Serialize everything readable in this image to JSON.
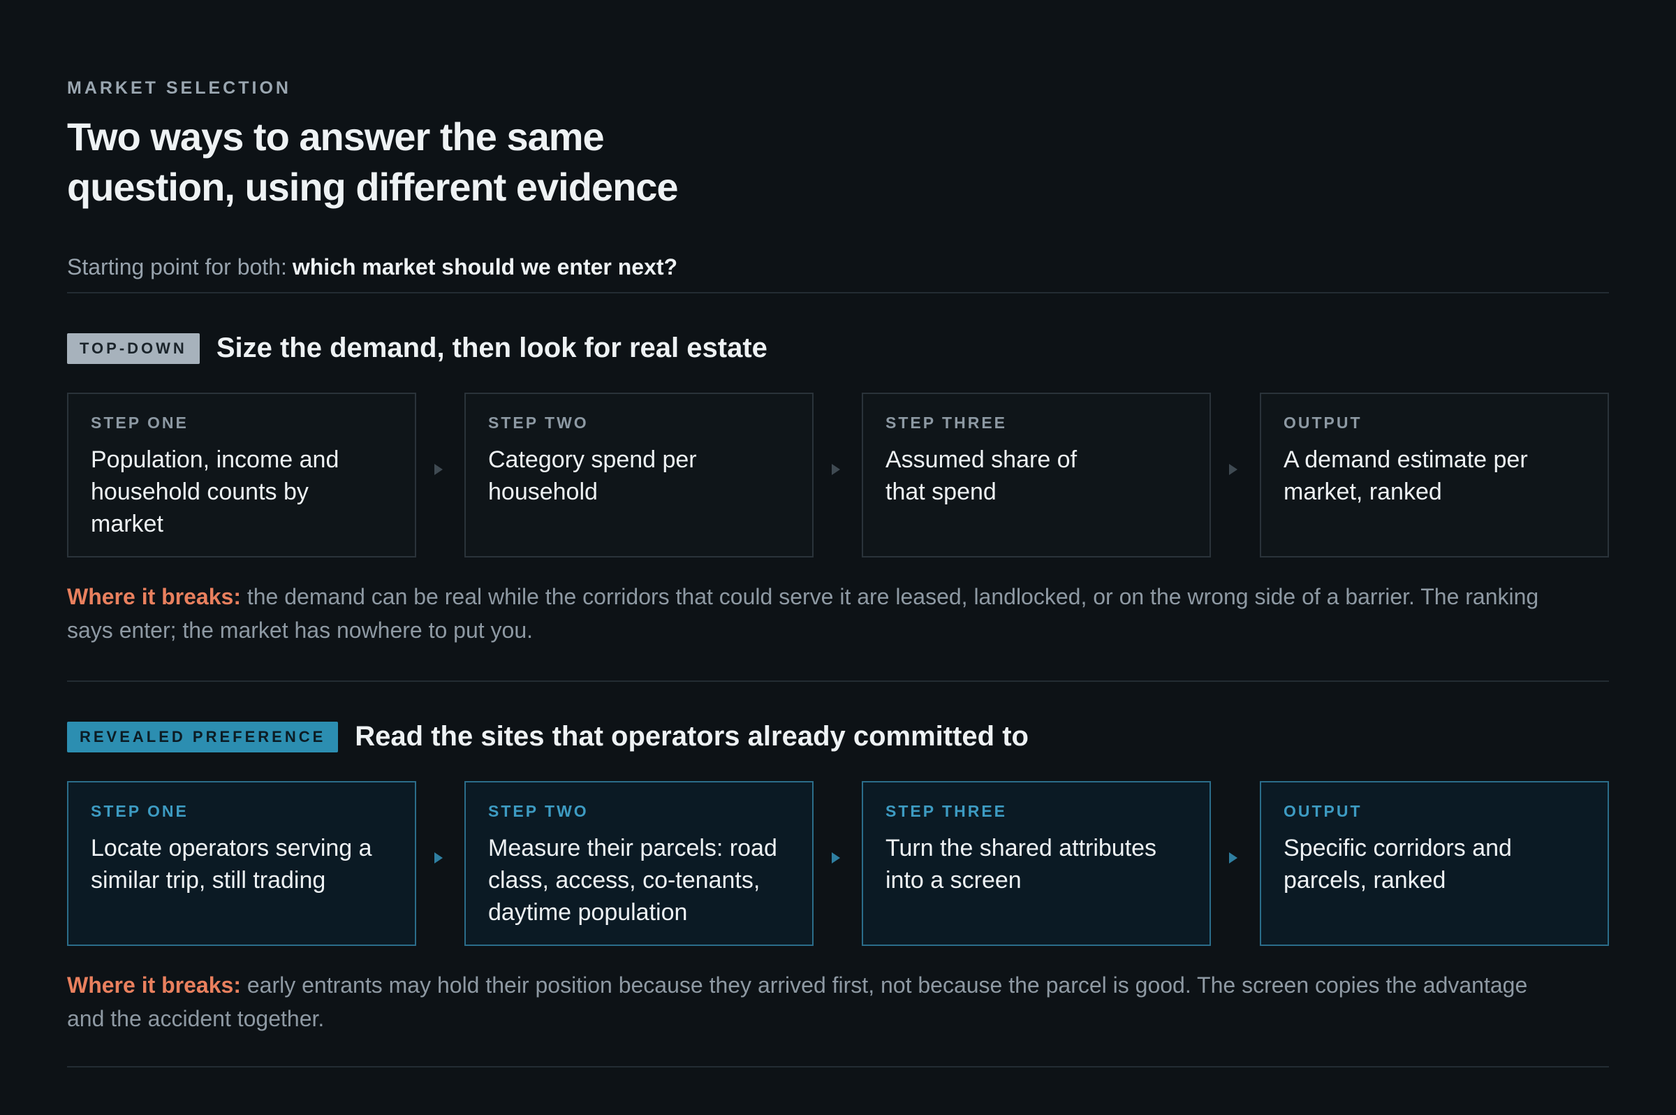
{
  "header": {
    "eyebrow": "MARKET SELECTION",
    "headline_line1": "Two ways to answer the same",
    "headline_line2": "question, using different evidence",
    "starting_prefix": "Starting point for both:",
    "starting_question": "which market should we enter next?"
  },
  "sections": [
    {
      "tag": "TOP-DOWN",
      "title": "Size the demand, then look for real estate",
      "steps": [
        {
          "label": "STEP ONE",
          "text": "Population, income and household counts by market"
        },
        {
          "label": "STEP TWO",
          "text": "Category spend per household"
        },
        {
          "label": "STEP THREE",
          "text": "Assumed share of that spend"
        },
        {
          "label": "OUTPUT",
          "text": "A demand estimate per market, ranked"
        }
      ],
      "breaks_label": "Where it breaks:",
      "breaks_text": "the demand can be real while the corridors that could serve it are leased, landlocked, or on the wrong side of a barrier. The ranking says enter; the market has nowhere to put you."
    },
    {
      "tag": "REVEALED PREFERENCE",
      "title": "Read the sites that operators already committed to",
      "steps": [
        {
          "label": "STEP ONE",
          "text": "Locate operators serving a similar trip, still trading"
        },
        {
          "label": "STEP TWO",
          "text": "Measure their parcels: road class, access, co-tenants, daytime population"
        },
        {
          "label": "STEP THREE",
          "text": "Turn the shared attributes into a screen"
        },
        {
          "label": "OUTPUT",
          "text": "Specific corridors and parcels, ranked"
        }
      ],
      "breaks_label": "Where it breaks:",
      "breaks_text": "early entrants may hold their position because they arrived first, not because the parcel is good. The screen copies the advantage and the accident together."
    }
  ],
  "colors": {
    "background": "#0d1216",
    "accent_blue": "#2c8eb1",
    "tag_gray": "#a7b2bc",
    "breaks_orange": "#e9805e"
  }
}
